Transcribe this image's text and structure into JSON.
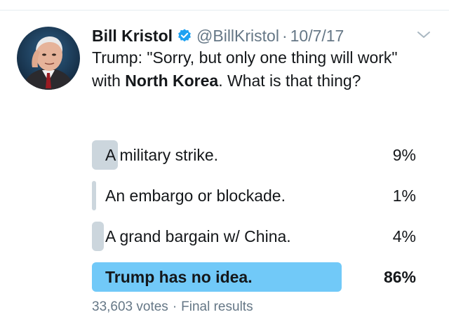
{
  "tweet": {
    "author_name": "Bill Kristol",
    "handle": "@BillKristol",
    "separator": "·",
    "date": "10/7/17",
    "text_before": "Trump: \"Sorry, but only one thing will work\" with ",
    "text_bold": "North Korea",
    "text_after": ". What is that thing?",
    "icons": {
      "verified": "verified-badge-icon",
      "menu": "chevron-down-icon"
    },
    "colors": {
      "verified": "#1da1f2",
      "winner_bar": "#71c9f8",
      "bar": "#ccd6dd",
      "secondary_text": "#657786"
    }
  },
  "poll": {
    "choices": [
      {
        "label": "A military strike.",
        "percent_text": "9%",
        "percent": 9
      },
      {
        "label": "An embargo or blockade.",
        "percent_text": "1%",
        "percent": 1
      },
      {
        "label": "A grand bargain w/ China.",
        "percent_text": "4%",
        "percent": 4
      },
      {
        "label": "Trump has no idea.",
        "percent_text": "86%",
        "percent": 86
      }
    ],
    "votes": "33,603 votes",
    "separator": "·",
    "status": "Final results"
  }
}
